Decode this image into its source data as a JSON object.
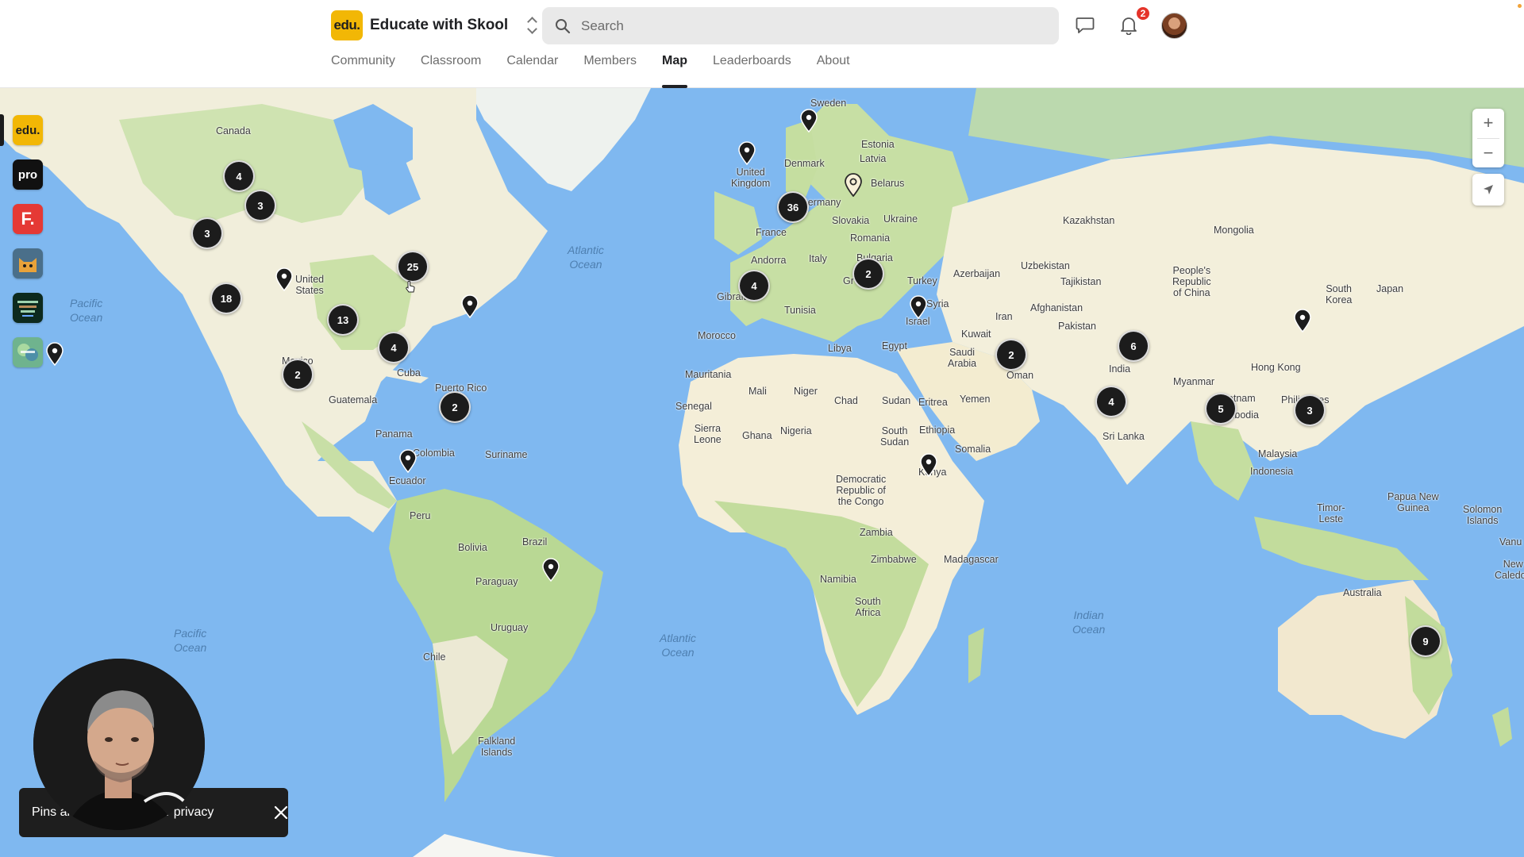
{
  "header": {
    "brand_logo_text": "edu.",
    "brand_name": "Educate with Skool",
    "search_placeholder": "Search",
    "notification_count": "2",
    "accent_color": "#f2b705"
  },
  "tabs": [
    {
      "label": "Community",
      "active": false
    },
    {
      "label": "Classroom",
      "active": false
    },
    {
      "label": "Calendar",
      "active": false
    },
    {
      "label": "Members",
      "active": false
    },
    {
      "label": "Map",
      "active": true
    },
    {
      "label": "Leaderboards",
      "active": false
    },
    {
      "label": "About",
      "active": false
    }
  ],
  "rail": {
    "communities": [
      {
        "text": "edu.",
        "color": "#f2b705",
        "icon": "edu-logo"
      },
      {
        "text": "pro",
        "color": "#111111",
        "icon": "pro-logo"
      },
      {
        "text": "F.",
        "color": "#e53935",
        "icon": "f-logo"
      },
      {
        "text": "",
        "color": "#4a6f8a",
        "icon": "cat-logo"
      },
      {
        "text": "",
        "color": "#0d2a1e",
        "icon": "inspire-logo"
      },
      {
        "text": "",
        "color": "#6fb38e",
        "icon": "green-logo"
      }
    ]
  },
  "map": {
    "labels": {
      "canada": "Canada",
      "united_states": "United\nStates",
      "mexico": "Mexico",
      "cuba": "Cuba",
      "guatemala": "Guatemala",
      "panama": "Panama",
      "puerto_rico": "Puerto Rico",
      "colombia": "Colombia",
      "suriname": "Suriname",
      "ecuador": "Ecuador",
      "peru": "Peru",
      "brazil": "Brazil",
      "bolivia": "Bolivia",
      "paraguay": "Paraguay",
      "uruguay": "Uruguay",
      "chile": "Chile",
      "falkland": "Falkland\nIslands",
      "sweden": "Sweden",
      "denmark": "Denmark",
      "united_kingdom": "United\nKingdom",
      "estonia": "Estonia",
      "latvia": "Latvia",
      "belarus": "Belarus",
      "germany": "Germany",
      "france": "France",
      "slovakia": "Slovakia",
      "ukraine": "Ukraine",
      "romania": "Romania",
      "bulgaria": "Bulgaria",
      "andorra": "Andorra",
      "italy": "Italy",
      "gibraltar": "Gibraltar",
      "greece": "Gr",
      "turkey": "Turkey",
      "azerbaijan": "Azerbaijan",
      "syria": "Syria",
      "israel": "Israel",
      "tunisia": "Tunisia",
      "morocco": "Morocco",
      "libya": "Libya",
      "egypt": "Egypt",
      "mauritania": "Mauritania",
      "mali": "Mali",
      "niger": "Niger",
      "chad": "Chad",
      "sudan": "Sudan",
      "eritrea": "Eritrea",
      "senegal": "Senegal",
      "sierra_leone": "Sierra\nLeone",
      "ghana": "Ghana",
      "nigeria": "Nigeria",
      "south_sudan": "South\nSudan",
      "ethiopia": "Ethiopia",
      "somalia": "Somalia",
      "kenya": "Kenya",
      "drc": "Democratic\nRepublic of\nthe Congo",
      "zambia": "Zambia",
      "zimbabwe": "Zimbabwe",
      "namibia": "Namibia",
      "south_africa": "South\nAfrica",
      "madagascar": "Madagascar",
      "kazakhstan": "Kazakhstan",
      "mongolia": "Mongolia",
      "uzbekistan": "Uzbekistan",
      "tajikistan": "Tajikistan",
      "afghanistan": "Afghanistan",
      "iran": "Iran",
      "kuwait": "Kuwait",
      "saudi_arabia": "Saudi\nArabia",
      "yemen": "Yemen",
      "oman": "Oman",
      "pakistan": "Pakistan",
      "india": "India",
      "sri_lanka": "Sri Lanka",
      "china": "People's\nRepublic\nof China",
      "south_korea": "South\nKorea",
      "japan": "Japan",
      "hong_kong": "Hong Kong",
      "myanmar": "Myanmar",
      "vietnam": "Vietnam",
      "cambodia": "Cambodia",
      "philippines": "Philippines",
      "malaysia": "Malaysia",
      "indonesia": "Indonesia",
      "papua": "Papua New\nGuinea",
      "timor": "Timor-\nLeste",
      "solomon": "Solomon\nIslands",
      "vanuatu": "Vanu",
      "new_caledonia": "New\nCaledon",
      "australia": "Australia"
    },
    "oceans": {
      "atlantic_north": "Atlantic\nOcean",
      "atlantic_south": "Atlantic\nOcean",
      "pacific_north": "Pacific\nOcean",
      "pacific_south": "Pacific\nOcean",
      "indian": "Indian\nOcean"
    },
    "clusters": [
      {
        "count": "4",
        "region": "western-canada"
      },
      {
        "count": "3",
        "region": "alberta"
      },
      {
        "count": "3",
        "region": "pacific-northwest"
      },
      {
        "count": "25",
        "region": "us-northeast"
      },
      {
        "count": "18",
        "region": "california"
      },
      {
        "count": "13",
        "region": "us-south"
      },
      {
        "count": "4",
        "region": "florida"
      },
      {
        "count": "2",
        "region": "mexico"
      },
      {
        "count": "2",
        "region": "caribbean"
      },
      {
        "count": "36",
        "region": "western-europe"
      },
      {
        "count": "4",
        "region": "iberia"
      },
      {
        "count": "2",
        "region": "balkans"
      },
      {
        "count": "2",
        "region": "gulf"
      },
      {
        "count": "6",
        "region": "north-india"
      },
      {
        "count": "4",
        "region": "south-india"
      },
      {
        "count": "5",
        "region": "southeast-asia"
      },
      {
        "count": "3",
        "region": "philippines"
      },
      {
        "count": "9",
        "region": "east-australia"
      }
    ],
    "pins": [
      {
        "region": "hawaii",
        "highlighted": false
      },
      {
        "region": "colorado",
        "highlighted": false
      },
      {
        "region": "bermuda",
        "highlighted": false
      },
      {
        "region": "ecuador",
        "highlighted": false
      },
      {
        "region": "south-brazil",
        "highlighted": false
      },
      {
        "region": "sweden",
        "highlighted": false
      },
      {
        "region": "uk",
        "highlighted": false
      },
      {
        "region": "poland",
        "highlighted": true
      },
      {
        "region": "israel",
        "highlighted": false
      },
      {
        "region": "kenya",
        "highlighted": false
      },
      {
        "region": "china-east",
        "highlighted": false
      }
    ],
    "controls": {
      "zoom_in": "+",
      "zoom_out": "−"
    },
    "colors": {
      "water": "#7fb8f0",
      "land": "#f3efde",
      "forest": "#c5dfa5",
      "cluster": "#1c1c1c",
      "highlight_pin": "#f2b705"
    }
  },
  "toast": {
    "text": "Pins are approximate for privacy"
  }
}
